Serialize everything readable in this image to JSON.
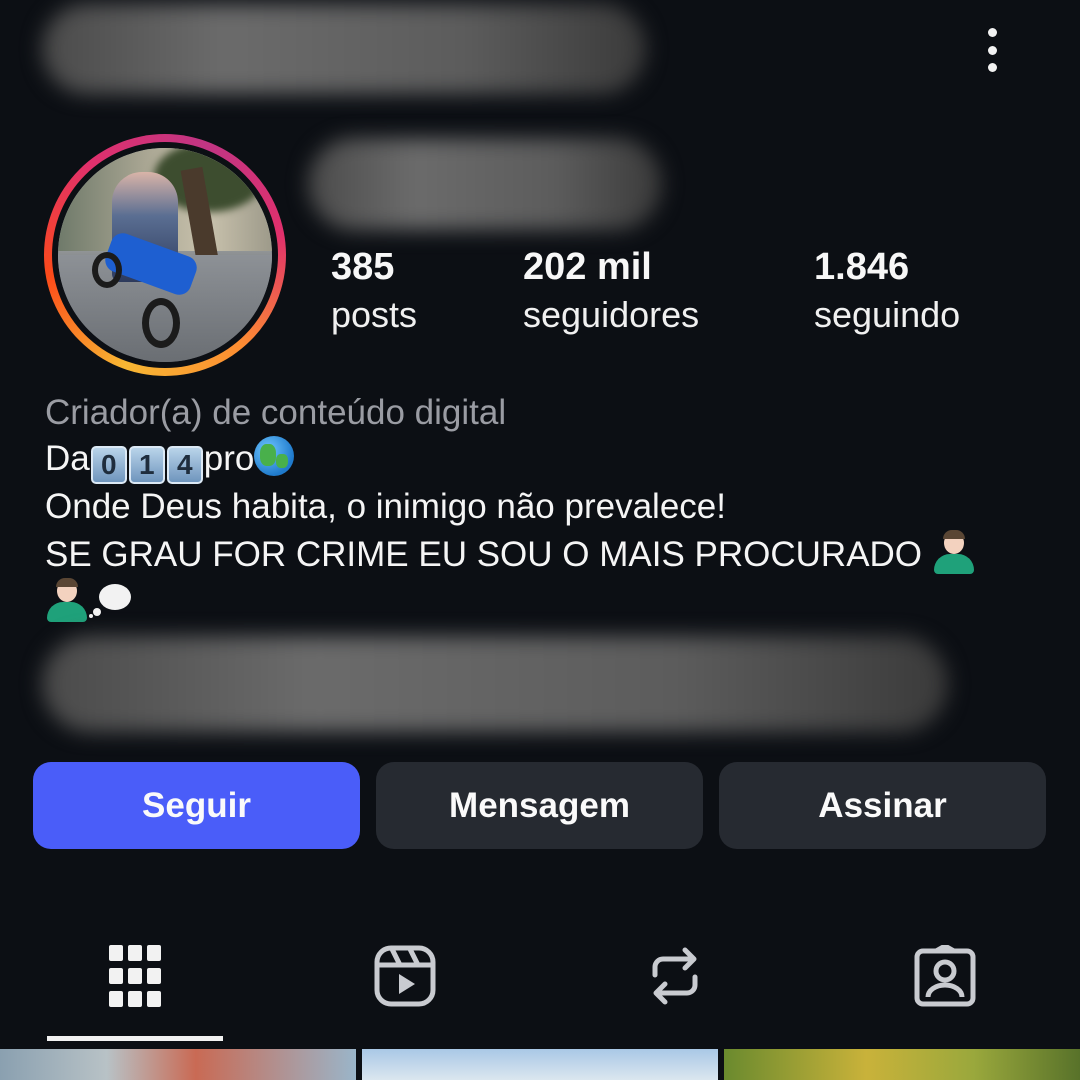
{
  "profile": {
    "stats": [
      {
        "value": "385",
        "label": "posts"
      },
      {
        "value": "202 mil",
        "label": "seguidores"
      },
      {
        "value": "1.846",
        "label": "seguindo"
      }
    ],
    "category": "Criador(a) de conteúdo digital",
    "bio": {
      "line1_prefix": "Da",
      "keycaps": [
        "0",
        "1",
        "4"
      ],
      "line1_suffix": "pro",
      "line2": "Onde Deus habita, o inimigo não prevalece!",
      "line3": "SE GRAU FOR CRIME EU SOU O MAIS PROCURADO"
    }
  },
  "actions": {
    "follow": "Seguir",
    "message": "Mensagem",
    "subscribe": "Assinar"
  },
  "icons": {
    "more": "more-vertical-icon",
    "tabs": [
      "grid-icon",
      "reels-icon",
      "reposts-icon",
      "tagged-icon"
    ],
    "bio_emojis": [
      "keycap-0",
      "keycap-1",
      "keycap-4",
      "globe-americas",
      "man-gesturing-no",
      "man-gesturing-no",
      "thought-balloon"
    ]
  },
  "colors": {
    "background": "#0c0f14",
    "follow_button": "#4a5df9",
    "secondary_button": "#262a31",
    "category_text": "#9a9ca3"
  },
  "active_tab": "grid"
}
